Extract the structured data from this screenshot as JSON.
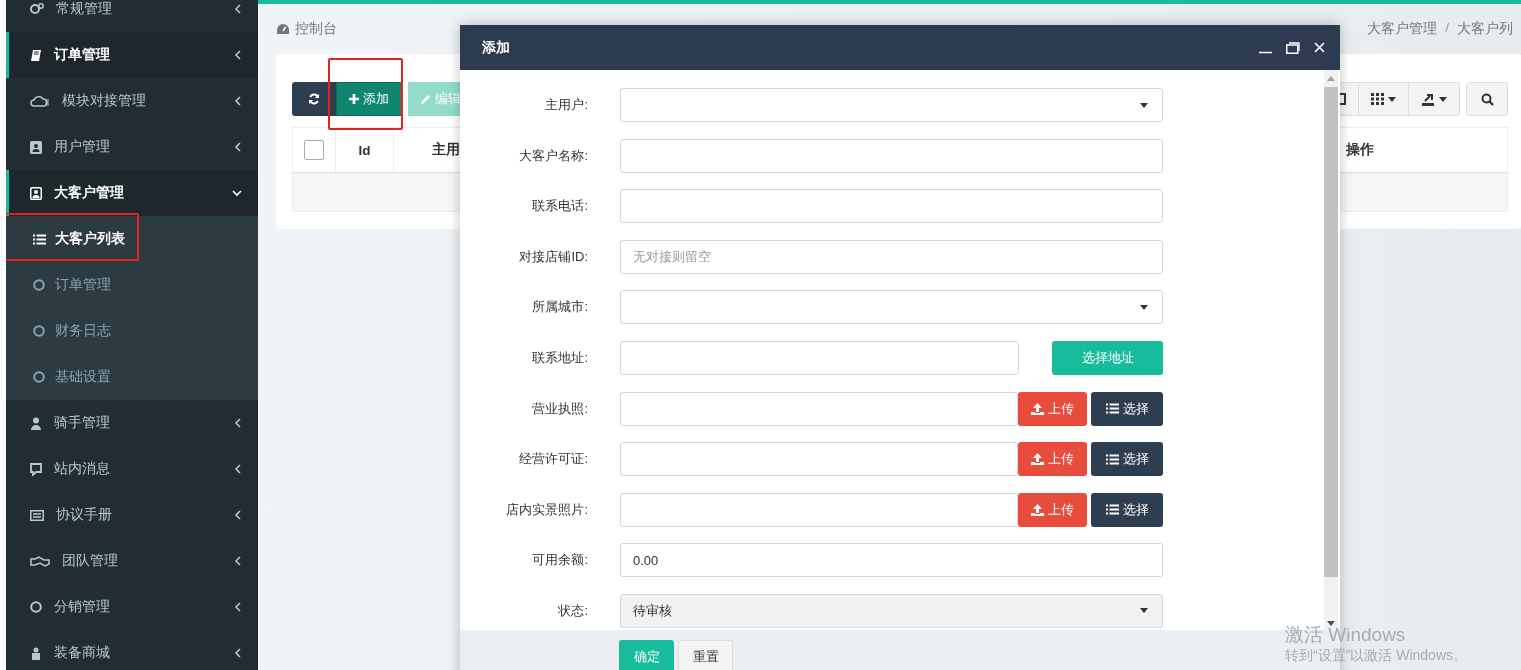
{
  "sidebar": {
    "items": [
      {
        "label": "常规管理",
        "active": false,
        "expanded": false
      },
      {
        "label": "订单管理",
        "active": true,
        "expanded": false
      },
      {
        "label": "模块对接管理",
        "active": false,
        "expanded": false
      },
      {
        "label": "用户管理",
        "active": false,
        "expanded": false
      },
      {
        "label": "大客户管理",
        "active": true,
        "expanded": true,
        "children": [
          {
            "label": "大客户列表",
            "selected": true,
            "highlighted": true
          },
          {
            "label": "订单管理",
            "selected": false,
            "highlighted": false
          },
          {
            "label": "财务日志",
            "selected": false,
            "highlighted": false
          },
          {
            "label": "基础设置",
            "selected": false,
            "highlighted": false
          }
        ]
      },
      {
        "label": "骑手管理",
        "active": false,
        "expanded": false
      },
      {
        "label": "站内消息",
        "active": false,
        "expanded": false
      },
      {
        "label": "协议手册",
        "active": false,
        "expanded": false
      },
      {
        "label": "团队管理",
        "active": false,
        "expanded": false
      },
      {
        "label": "分销管理",
        "active": false,
        "expanded": false
      },
      {
        "label": "装备商城",
        "active": false,
        "expanded": false
      }
    ]
  },
  "breadcrumb": {
    "home": "控制台",
    "separator": "/",
    "trail": [
      "大客户管理",
      "大客户列"
    ]
  },
  "toolbar": {
    "add": {
      "label": "添加",
      "highlighted": true
    },
    "edit": {
      "label": "编辑",
      "disabled": true
    }
  },
  "table": {
    "select_all": {
      "checked": false
    },
    "columns": [
      "Id",
      "主用",
      "操作"
    ]
  },
  "modal": {
    "title": "添加",
    "fields": [
      {
        "label": "主用户:",
        "kind": "select"
      },
      {
        "label": "大客户名称:",
        "kind": "text"
      },
      {
        "label": "联系电话:",
        "kind": "text"
      },
      {
        "label": "对接店铺ID:",
        "kind": "text",
        "placeholder": "无对接则留空"
      },
      {
        "label": "所属城市:",
        "kind": "select"
      },
      {
        "label": "联系地址:",
        "kind": "address",
        "button": "选择地址"
      },
      {
        "label": "营业执照:",
        "kind": "upload",
        "upload": "上传",
        "choose": "选择"
      },
      {
        "label": "经营许可证:",
        "kind": "upload",
        "upload": "上传",
        "choose": "选择"
      },
      {
        "label": "店内实景照片:",
        "kind": "upload",
        "upload": "上传",
        "choose": "选择"
      },
      {
        "label": "可用余额:",
        "kind": "text",
        "value": "0.00"
      },
      {
        "label": "状态:",
        "kind": "select",
        "value": "待审核",
        "disabled": true
      }
    ],
    "buttons": [
      "确定",
      "重置"
    ]
  },
  "os_notice": {
    "title": "激活 Windows",
    "text": "转到“设置”以激活 Windows。"
  }
}
